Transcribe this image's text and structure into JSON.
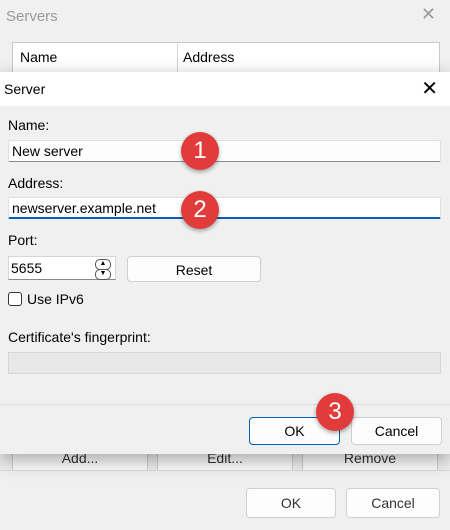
{
  "background_dialog": {
    "title": "Servers",
    "table_headers": [
      "Name",
      "Address"
    ],
    "buttons": {
      "add": "Add...",
      "edit": "Edit...",
      "remove": "Remove",
      "ok": "OK",
      "cancel": "Cancel"
    }
  },
  "dialog": {
    "title": "Server",
    "name_label": "Name:",
    "name_value": "New server",
    "address_label": "Address:",
    "address_value": "newserver.example.net",
    "port_label": "Port:",
    "port_value": "5655",
    "reset_label": "Reset",
    "ipv6_label": "Use IPv6",
    "ipv6_checked": false,
    "fingerprint_label": "Certificate's fingerprint:",
    "fingerprint_value": "",
    "ok_label": "OK",
    "cancel_label": "Cancel"
  },
  "markers": [
    "1",
    "2",
    "3"
  ],
  "colors": {
    "accent": "#005fb8",
    "marker": "#e23b3b"
  }
}
